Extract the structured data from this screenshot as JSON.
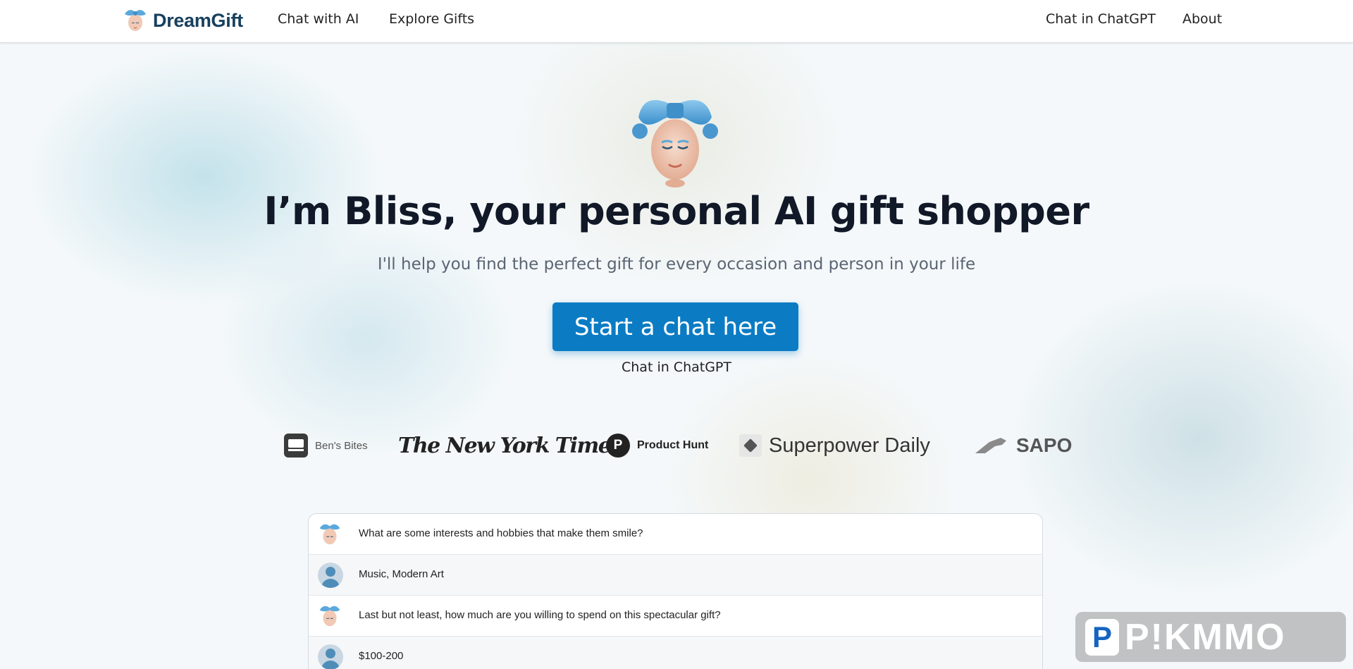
{
  "nav": {
    "brand": "DreamGift",
    "left_links": [
      "Chat with AI",
      "Explore Gifts"
    ],
    "right_links": [
      "Chat in ChatGPT",
      "About"
    ]
  },
  "hero": {
    "title": "I’m Bliss, your personal AI gift shopper",
    "subtitle": "I'll help you find the perfect gift for every occasion and person in your life",
    "cta_label": "Start a chat here",
    "secondary_link": "Chat in ChatGPT"
  },
  "press": {
    "bens_bites": "Ben's Bites",
    "nyt": "The New York Times",
    "product_hunt": "Product Hunt",
    "product_hunt_mark": "P",
    "superpower": "Superpower Daily",
    "sapo": "SAPO"
  },
  "chat": [
    {
      "role": "bot",
      "text": "What are some interests and hobbies that make them smile?"
    },
    {
      "role": "user",
      "text": "Music, Modern Art"
    },
    {
      "role": "bot",
      "text": "Last but not least, how much are you willing to spend on this spectacular gift?"
    },
    {
      "role": "user",
      "text": "$100-200"
    }
  ],
  "watermark": {
    "mark": "P",
    "text": "P!KMMO"
  },
  "colors": {
    "accent": "#0b7cc4",
    "brand_text": "#17405e",
    "bow_blue": "#5aa8dc"
  }
}
